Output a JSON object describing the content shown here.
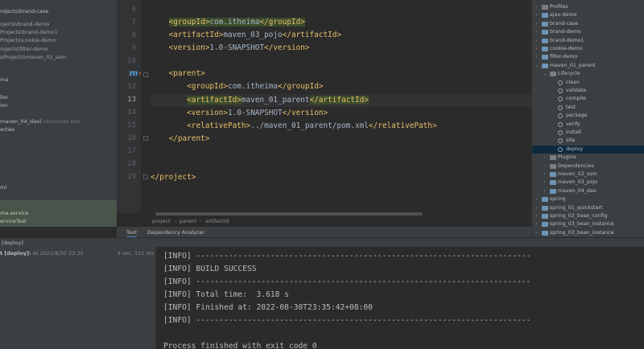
{
  "project_panel": {
    "rows": [
      {
        "text": "rojects\\brand-case",
        "grey": ""
      },
      {
        "text": "ojects\\brand-demo",
        "grey": ""
      },
      {
        "text": "Projects\\brand-demo1",
        "grey": ""
      },
      {
        "text": "Projects\\cookie-demo",
        "grey": ""
      },
      {
        "text": "rojects\\filter-demo",
        "grey": ""
      },
      {
        "text": "aProjects\\maven_02_ssm",
        "grey": ""
      },
      {
        "text": "ma",
        "grey": ""
      },
      {
        "text": "ller",
        "grey": ""
      },
      {
        "text": "ion",
        "grey": ""
      },
      {
        "text": "maven_04_dao)",
        "grey": "resources root"
      },
      {
        "text": "erties",
        "grey": ""
      },
      {
        "text": "ml",
        "grey": ""
      }
    ],
    "selected_rows": [
      "ma.service",
      "erviceTest"
    ]
  },
  "editor": {
    "line_numbers": [
      "6",
      "7",
      "8",
      "9",
      "10",
      "11",
      "12",
      "13",
      "14",
      "15",
      "16",
      "17",
      "18",
      "19"
    ],
    "current_line": "13",
    "maven_marker": "m",
    "code": [
      {
        "indent": "    ",
        "open": "<groupId>",
        "text": "com.itheima",
        "close": "</groupId>"
      },
      {
        "indent": "    ",
        "open": "<artifactId>",
        "text": "maven_03_pojo",
        "close": "</artifactId>"
      },
      {
        "indent": "    ",
        "open": "<version>",
        "text": "1.0-SNAPSHOT",
        "close": "</version>"
      },
      {
        "indent": "",
        "open": "",
        "text": "",
        "close": ""
      },
      {
        "indent": "    ",
        "open": "<parent>",
        "text": "",
        "close": ""
      },
      {
        "indent": "        ",
        "open": "<groupId>",
        "text": "com.itheima",
        "close": "</groupId>"
      },
      {
        "indent": "        ",
        "open": "<artifactId>",
        "text": "maven_01_parent",
        "close": "</artifactId>"
      },
      {
        "indent": "        ",
        "open": "<version>",
        "text": "1.0-SNAPSHOT",
        "close": "</version>"
      },
      {
        "indent": "        ",
        "open": "<relativePath>",
        "text": "../maven_01_parent/pom.xml",
        "close": "</relativePath>"
      },
      {
        "indent": "    ",
        "open": "</parent>",
        "text": "",
        "close": ""
      },
      {
        "indent": "",
        "open": "",
        "text": "",
        "close": ""
      },
      {
        "indent": "",
        "open": "",
        "text": "",
        "close": ""
      },
      {
        "indent": "",
        "open": "</project>",
        "text": "",
        "close": ""
      }
    ],
    "breadcrumb": [
      "project",
      "parent",
      "artifactId"
    ],
    "bottom_tabs": [
      "Text",
      "Dependency Analyzer"
    ]
  },
  "maven_tree": [
    {
      "label": "Profiles",
      "kind": "folder",
      "level": 1,
      "arrow": "›"
    },
    {
      "label": "ajax-demo",
      "kind": "module",
      "level": 1,
      "arrow": "›"
    },
    {
      "label": "brand-case",
      "kind": "module",
      "level": 1,
      "arrow": "›"
    },
    {
      "label": "brand-demo",
      "kind": "module",
      "level": 1,
      "arrow": "›"
    },
    {
      "label": "brand-demo1",
      "kind": "module",
      "level": 1,
      "arrow": "›"
    },
    {
      "label": "cookie-demo",
      "kind": "module",
      "level": 1,
      "arrow": "›"
    },
    {
      "label": "filter-demo",
      "kind": "module",
      "level": 1,
      "arrow": "›"
    },
    {
      "label": "maven_01_parent",
      "kind": "module",
      "level": 1,
      "arrow": "⌄"
    },
    {
      "label": "Lifecycle",
      "kind": "folder",
      "level": 2,
      "arrow": "⌄"
    },
    {
      "label": "clean",
      "kind": "goal",
      "level": 3,
      "arrow": ""
    },
    {
      "label": "validate",
      "kind": "goal",
      "level": 3,
      "arrow": ""
    },
    {
      "label": "compile",
      "kind": "goal",
      "level": 3,
      "arrow": ""
    },
    {
      "label": "test",
      "kind": "goal",
      "level": 3,
      "arrow": ""
    },
    {
      "label": "package",
      "kind": "goal",
      "level": 3,
      "arrow": ""
    },
    {
      "label": "verify",
      "kind": "goal",
      "level": 3,
      "arrow": ""
    },
    {
      "label": "install",
      "kind": "goal",
      "level": 3,
      "arrow": ""
    },
    {
      "label": "site",
      "kind": "goal",
      "level": 3,
      "arrow": ""
    },
    {
      "label": "deploy",
      "kind": "goal",
      "level": 3,
      "arrow": "",
      "selected": true
    },
    {
      "label": "Plugins",
      "kind": "folder",
      "level": 2,
      "arrow": "›"
    },
    {
      "label": "Dependencies",
      "kind": "folder",
      "level": 2,
      "arrow": "›"
    },
    {
      "label": "maven_02_ssm",
      "kind": "module",
      "level": 2,
      "arrow": "›"
    },
    {
      "label": "maven_03_pojo",
      "kind": "module",
      "level": 2,
      "arrow": "›"
    },
    {
      "label": "maven_04_dao",
      "kind": "module",
      "level": 2,
      "arrow": "›"
    },
    {
      "label": "spring",
      "kind": "module",
      "level": 1,
      "arrow": "›"
    },
    {
      "label": "spring_01_quickstart",
      "kind": "module",
      "level": 1,
      "arrow": "›"
    },
    {
      "label": "spring_02_base_config",
      "kind": "module",
      "level": 1,
      "arrow": "›"
    },
    {
      "label": "spring_03_bean_instance",
      "kind": "module",
      "level": 1,
      "arrow": "›"
    },
    {
      "label": "spring_03_bean_instance",
      "kind": "module",
      "level": 1,
      "arrow": "›"
    }
  ],
  "run": {
    "title": "[deploy]",
    "item": "t [deploy]:",
    "item_time": "At 2022/8/30 23:35",
    "duration": "4 sec, 321 ms",
    "console": [
      "[INFO] ------------------------------------------------------------------------",
      "[INFO] BUILD SUCCESS",
      "[INFO] ------------------------------------------------------------------------",
      "[INFO] Total time:  3.618 s",
      "[INFO] Finished at: 2022-08-30T23:35:42+08:00",
      "[INFO] ------------------------------------------------------------------------",
      "",
      "Process finished with exit code 0"
    ]
  },
  "colors": {
    "tag": "#e8bf6a",
    "highlight": "#3b4b2c",
    "selection": "#0d293e",
    "maven_marker": "#4a9eda"
  }
}
